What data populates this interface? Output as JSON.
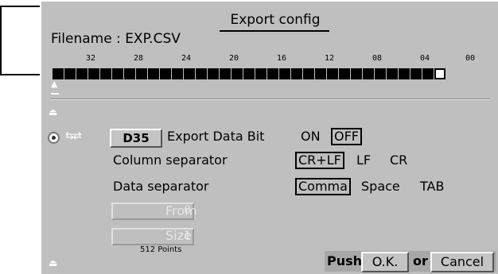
{
  "dialog": {
    "title": "Export config",
    "filename_label": "Filename : EXP.CSV"
  },
  "bit_ruler": {
    "ticks": [
      "32",
      "28",
      "24",
      "20",
      "16",
      "12",
      "08",
      "04",
      "00"
    ],
    "bit_count": 33,
    "selected_bit_index": 32
  },
  "export_data_bit": {
    "device": "D35",
    "label": "Export Data Bit",
    "options": [
      "ON",
      "OFF"
    ],
    "selected": "OFF"
  },
  "column_separator": {
    "label": "Column separator",
    "options": [
      "CR+LF",
      "LF",
      "CR"
    ],
    "selected": "CR+LF"
  },
  "data_separator": {
    "label": "Data separator",
    "options": [
      "Comma",
      "Space",
      "TAB"
    ],
    "selected": "Comma"
  },
  "range": {
    "from_value": "0",
    "from_label": "From",
    "size_value": "1",
    "size_label": "Size",
    "points_note": "512 Points"
  },
  "footer": {
    "push_label": "Push",
    "ok_label": "O.K.",
    "or_label": "or",
    "cancel_label": "Cancel"
  },
  "icons": {
    "pointer": "up-arrow-icon",
    "cursor_mark": "cursor-mark-icon",
    "radio": "radio-selected-icon",
    "swap": "swap-arrows-icon"
  }
}
